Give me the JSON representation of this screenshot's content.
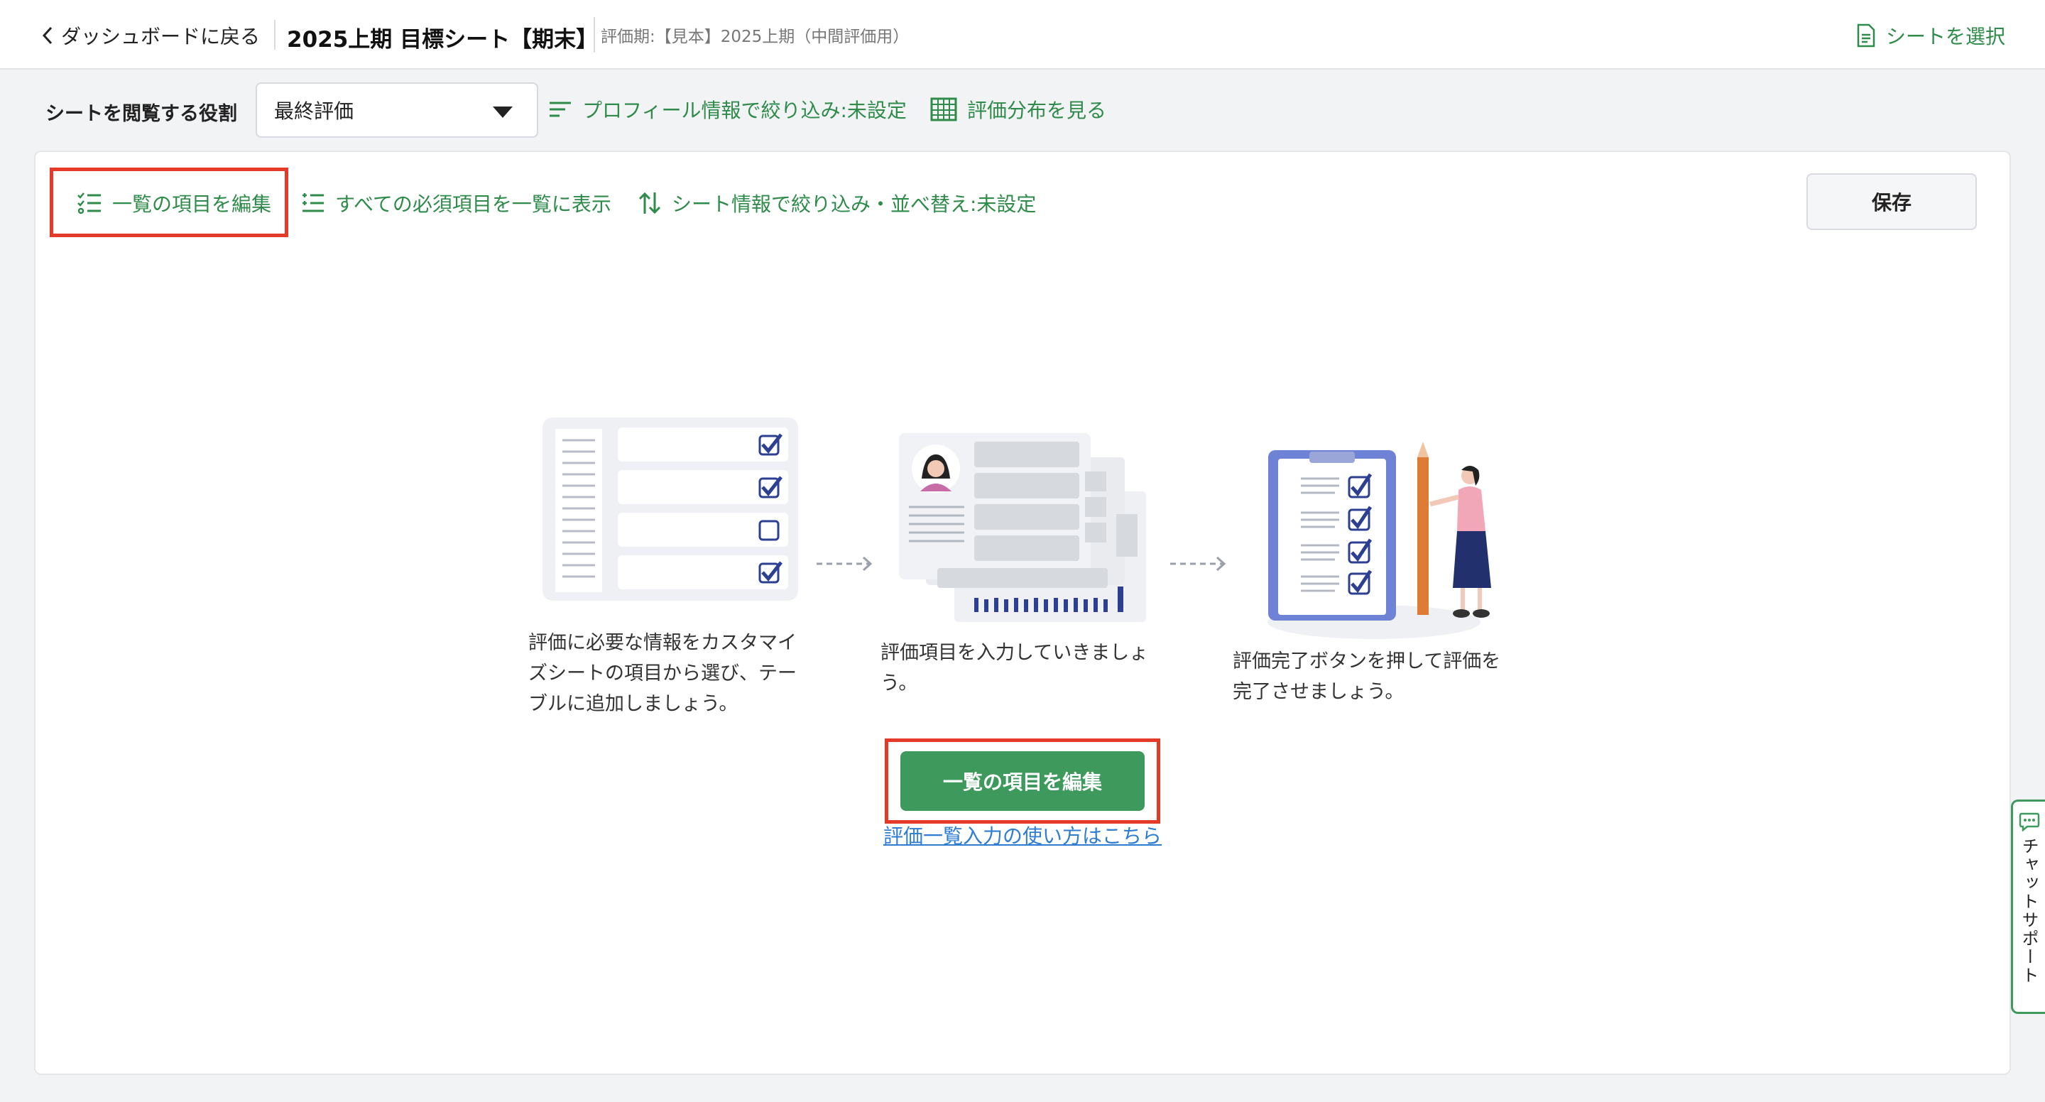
{
  "header": {
    "back_label": "ダッシュボードに戻る",
    "title": "2025上期 目標シート【期末】",
    "period": "評価期:【見本】2025上期（中間評価用）",
    "select_sheet_label": "シートを選択"
  },
  "filters": {
    "role_label": "シートを閲覧する役割",
    "role_value": "最終評価",
    "profile_filter_label": "プロフィール情報で絞り込み:未設定",
    "distribution_label": "評価分布を見る"
  },
  "toolbar": {
    "edit_items_label": "一覧の項目を編集",
    "show_required_label": "すべての必須項目を一覧に表示",
    "sheet_filter_label": "シート情報で絞り込み・並べ替え:未設定",
    "save_label": "保存"
  },
  "steps": [
    {
      "text_lines": [
        "評価に必要な情報をカスタマイ",
        "ズシートの項目から選び、テー",
        "ブルに追加しましょう。"
      ]
    },
    {
      "text_lines": [
        "評価項目を入力していきましょ",
        "う。"
      ]
    },
    {
      "text_lines": [
        "評価完了ボタンを押して評価を",
        "完了させましょう。"
      ]
    }
  ],
  "cta": {
    "button_label": "一覧の項目を編集",
    "help_link": "評価一覧入力の使い方はこちら"
  },
  "chat": {
    "label": "チャットサポート"
  },
  "colors": {
    "accent_green": "#3d9a5c",
    "highlight_red": "#e53a2a",
    "link_blue": "#2f7dd3",
    "check_navy": "#2c3f91"
  }
}
